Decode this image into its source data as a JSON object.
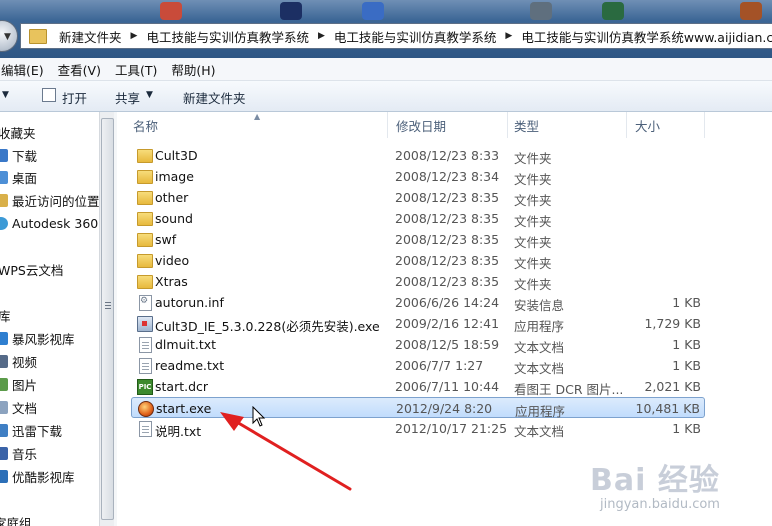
{
  "address": {
    "crumbs": [
      "新建文件夹",
      "电工技能与实训仿真教学系统",
      "电工技能与实训仿真教学系统",
      "电工技能与实训仿真教学系统www.aijidian.com"
    ]
  },
  "menubar": {
    "items": [
      "编辑(E)",
      "查看(V)",
      "工具(T)",
      "帮助(H)"
    ]
  },
  "toolbar": {
    "open": "打开",
    "share": "共享",
    "new_folder": "新建文件夹"
  },
  "nav": {
    "items": [
      {
        "label": "收藏夹"
      },
      {
        "label": "下载"
      },
      {
        "label": "桌面"
      },
      {
        "label": "最近访问的位置"
      },
      {
        "label": "Autodesk 360"
      },
      {
        "label": "WPS云文档"
      },
      {
        "label": "库"
      },
      {
        "label": "暴风影视库"
      },
      {
        "label": "视频"
      },
      {
        "label": "图片"
      },
      {
        "label": "文档"
      },
      {
        "label": "迅雷下载"
      },
      {
        "label": "音乐"
      },
      {
        "label": "优酷影视库"
      },
      {
        "label": "家庭组"
      }
    ]
  },
  "columns": {
    "name": "名称",
    "date": "修改日期",
    "type": "类型",
    "size": "大小"
  },
  "files": [
    {
      "name": "Cult3D",
      "date": "2008/12/23 8:33",
      "type": "文件夹",
      "size": "",
      "icon": "folder-icon"
    },
    {
      "name": "image",
      "date": "2008/12/23 8:34",
      "type": "文件夹",
      "size": "",
      "icon": "folder-icon"
    },
    {
      "name": "other",
      "date": "2008/12/23 8:35",
      "type": "文件夹",
      "size": "",
      "icon": "folder-icon"
    },
    {
      "name": "sound",
      "date": "2008/12/23 8:35",
      "type": "文件夹",
      "size": "",
      "icon": "folder-icon"
    },
    {
      "name": "swf",
      "date": "2008/12/23 8:35",
      "type": "文件夹",
      "size": "",
      "icon": "folder-icon"
    },
    {
      "name": "video",
      "date": "2008/12/23 8:35",
      "type": "文件夹",
      "size": "",
      "icon": "folder-icon"
    },
    {
      "name": "Xtras",
      "date": "2008/12/23 8:35",
      "type": "文件夹",
      "size": "",
      "icon": "folder-icon"
    },
    {
      "name": "autorun.inf",
      "date": "2006/6/26 14:24",
      "type": "安装信息",
      "size": "1 KB",
      "icon": "settings-file-icon"
    },
    {
      "name": "Cult3D_IE_5.3.0.228(必须先安装).exe",
      "date": "2009/2/16 12:41",
      "type": "应用程序",
      "size": "1,729 KB",
      "icon": "installer-icon"
    },
    {
      "name": "dlmuit.txt",
      "date": "2008/12/5 18:59",
      "type": "文本文档",
      "size": "1 KB",
      "icon": "text-file-icon"
    },
    {
      "name": "readme.txt",
      "date": "2006/7/7 1:27",
      "type": "文本文档",
      "size": "1 KB",
      "icon": "text-file-icon"
    },
    {
      "name": "start.dcr",
      "date": "2006/7/11 10:44",
      "type": "看图王 DCR 图片...",
      "size": "2,021 KB",
      "icon": "picture-file-icon"
    },
    {
      "name": "start.exe",
      "date": "2012/9/24 8:20",
      "type": "应用程序",
      "size": "10,481 KB",
      "icon": "application-icon",
      "selected": true
    },
    {
      "name": "说明.txt",
      "date": "2012/10/17 21:25",
      "type": "文本文档",
      "size": "1 KB",
      "icon": "text-file-icon"
    }
  ],
  "watermark": {
    "main": "Bai 经验",
    "sub": "jingyan.baidu.com"
  },
  "colors": {
    "accent": "#2e5684",
    "selection": "#c1dcfc",
    "annotation_arrow": "#e02020"
  }
}
